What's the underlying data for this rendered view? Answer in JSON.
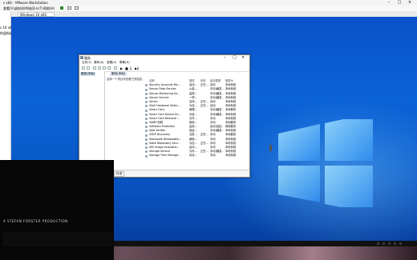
{
  "vmware": {
    "title": "s x64 - VMware Workstation",
    "menus": [
      "查看(V)",
      "虚拟机(M)",
      "选项卡(T)",
      "帮助(H)"
    ],
    "library_items": [
      "s 10 x64",
      "的虚拟机"
    ],
    "tab": "Windows 10 x64"
  },
  "services_window": {
    "title": "服务",
    "menus": [
      "文件(F)",
      "操作(A)",
      "查看(V)",
      "帮助(H)"
    ],
    "tree_node": "服务(本地)",
    "header_tab": "服务(本地)",
    "description": "选择一个项目来查看它的描述。",
    "columns": [
      "名称",
      "描述",
      "状态",
      "启动类型",
      "登录为"
    ],
    "rows": [
      [
        "Security Accounts Ma...",
        "启动...",
        "正在...",
        "自动",
        "本地系统"
      ],
      [
        "Sensor Data Service",
        "从各...",
        "",
        "手动(触发...",
        "本地系统"
      ],
      [
        "Sensor Monitoring Se...",
        "监视...",
        "",
        "手动(触发...",
        "本地系统"
      ],
      [
        "Sensor Service",
        "一项...",
        "",
        "手动(触发...",
        "本地系统"
      ],
      [
        "Server",
        "支持...",
        "正在...",
        "自动",
        "本地系统"
      ],
      [
        "Shell Hardware Detec...",
        "为自...",
        "正在...",
        "自动",
        "本地系统"
      ],
      [
        "Smart Card",
        "管理...",
        "",
        "手动(触发...",
        "本地服务"
      ],
      [
        "Smart Card Device En...",
        "为给...",
        "",
        "手动(触发...",
        "本地系统"
      ],
      [
        "Smart Card Removal ...",
        "允许...",
        "",
        "手动",
        "本地系统"
      ],
      [
        "SNMP 陷阱",
        "接收...",
        "",
        "手动",
        "本地服务"
      ],
      [
        "Software Protection",
        "启用...",
        "",
        "自动(延迟...",
        "网络服务"
      ],
      [
        "Spot Verifier",
        "验证...",
        "",
        "手动(触发...",
        "本地系统"
      ],
      [
        "SSDP Discovery",
        "当发...",
        "正在...",
        "手动",
        "本地服务"
      ],
      [
        "Stackwalk WindowsBa...",
        "使用...",
        "",
        "手动",
        "本地系统"
      ],
      [
        "State Repository Serv...",
        "为应...",
        "正在...",
        "手动",
        "本地系统"
      ],
      [
        "Still Image Acquisitio...",
        "启动...",
        "",
        "手动",
        "本地系统"
      ],
      [
        "Storage Service",
        "为存...",
        "正在...",
        "手动(触发...",
        "本地系统"
      ],
      [
        "Storage Tiers Manage...",
        "优化...",
        "",
        "手动",
        "本地系统"
      ]
    ],
    "bottom_tabs": [
      "扩展",
      "标准"
    ]
  },
  "overlay": {
    "credit": "A STEFAN FORSTER PRODUCTION"
  },
  "colors": {
    "desktop_blue": "#0b63d8",
    "logo_glow": "#7fd0ff"
  }
}
